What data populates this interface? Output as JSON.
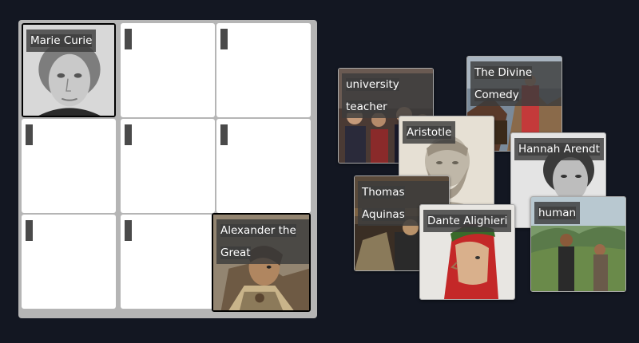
{
  "board": {
    "cells": [
      {
        "label": "Marie Curie",
        "filled": true
      },
      {
        "label": "",
        "filled": false
      },
      {
        "label": "",
        "filled": false
      },
      {
        "label": "",
        "filled": false
      },
      {
        "label": "",
        "filled": false
      },
      {
        "label": "",
        "filled": false
      },
      {
        "label": "",
        "filled": false
      },
      {
        "label": "",
        "filled": false
      },
      {
        "label": "Alexander the Great",
        "filled": true
      }
    ]
  },
  "cards": {
    "university_teacher": "university teacher",
    "divine_comedy": "The Divine Comedy",
    "aristotle": "Aristotle",
    "hannah_arendt": "Hannah Arendt",
    "thomas_aquinas": "Thomas Aquinas",
    "dante_alighieri": "Dante Alighieri",
    "human": "human"
  },
  "colors": {
    "background": "#131722",
    "board": "#b5b5b5",
    "label_bg": "#3c3c3c"
  }
}
